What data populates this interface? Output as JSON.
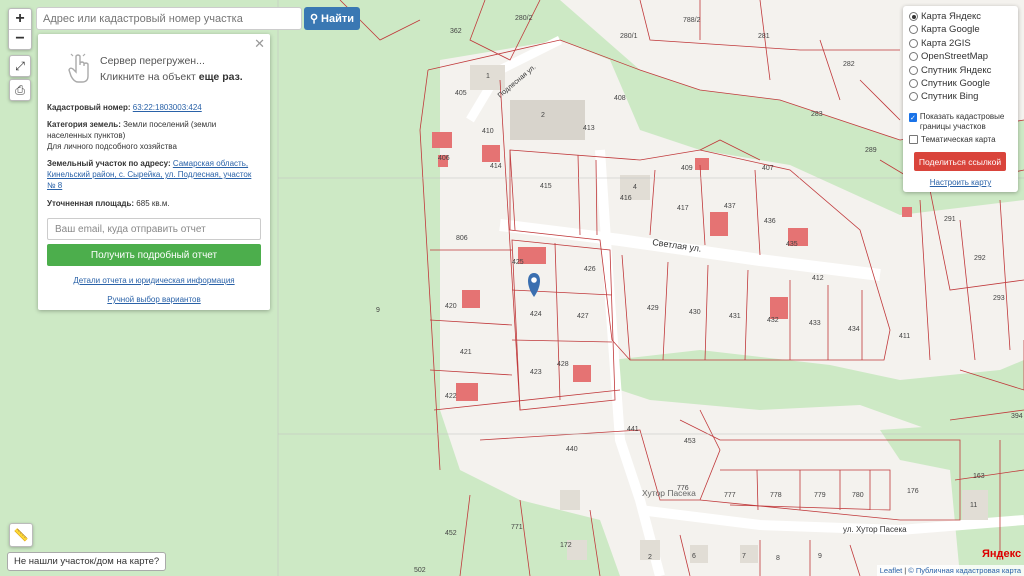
{
  "search": {
    "placeholder": "Адрес или кадастровый номер участка",
    "button": "Найти"
  },
  "zoom": {
    "in": "+",
    "out": "−"
  },
  "panel": {
    "server_line1": "Сервер перегружен...",
    "server_line2": "Кликните на объект",
    "server_line2b": "еще раз.",
    "cad_label": "Кадастровый номер:",
    "cad_value": "63:22:1803003:424",
    "cat_label": "Категория земель:",
    "cat_value": "Земли поселений (земли населенных пунктов)",
    "use": "Для личного подсобного хозяйства",
    "addr_label": "Земельный участок по адресу:",
    "addr_value": "Самарская область, Кинельский район, с. Сырейка, ул. Подлесная, участок № 8",
    "area_label": "Уточненная площадь:",
    "area_value": "685 кв.м.",
    "email_placeholder": "Ваш email, куда отправить отчет",
    "report_btn": "Получить подробный отчет",
    "details_link": "Детали отчета и юридическая информация",
    "manual_link": "Ручной выбор вариантов"
  },
  "layers": {
    "options": [
      "Карта Яндекс",
      "Карта Google",
      "Карта 2GIS",
      "OpenStreetMap",
      "Спутник Яндекс",
      "Спутник Google",
      "Спутник Bing"
    ],
    "selected": "Карта Яндекс",
    "chk_borders": "Показать кадастровые границы участков",
    "chk_thematic": "Тематическая карта",
    "share": "Поделиться ссылкой",
    "setup": "Настроить карту"
  },
  "notfound": "Не нашли участок/дом на карте?",
  "attribution": {
    "leaflet": "Leaflet",
    "sep": "|",
    "pkk": "© Публичная кадастровая карта"
  },
  "yandex": "Яндекс",
  "streets": {
    "svetlaya": "Светлая ул.",
    "podlesnaya": "Подлесная ул.",
    "hutor1": "Хутор Пасека",
    "hutor2": "ул. Хутор Пасека"
  },
  "parcels": [
    "362",
    "280/2",
    "788/2",
    "280/1",
    "281",
    "1",
    "405",
    "408",
    "2",
    "413",
    "410",
    "414",
    "415",
    "416",
    "4",
    "417",
    "437",
    "436",
    "435",
    "409",
    "407",
    "283",
    "282",
    "289",
    "412",
    "291",
    "292",
    "293",
    "406",
    "806",
    "425",
    "426",
    "424",
    "427",
    "429",
    "430",
    "431",
    "432",
    "433",
    "434",
    "420",
    "421",
    "423",
    "428",
    "422",
    "411",
    "9",
    "441",
    "440",
    "453",
    "776",
    "777",
    "778",
    "779",
    "780",
    "176",
    "163",
    "11",
    "452",
    "771",
    "172",
    "2",
    "6",
    "7",
    "8",
    "9",
    "502",
    "394"
  ],
  "colors": {
    "parcel_line": "#c0393b",
    "forest": "#cde9c5",
    "land": "#f4f2ee",
    "road": "#ffffff",
    "building": "#e8e4dc",
    "house_red": "#e57373",
    "share": "#d9443b",
    "report": "#4cae4c",
    "accent": "#3a78b3"
  }
}
